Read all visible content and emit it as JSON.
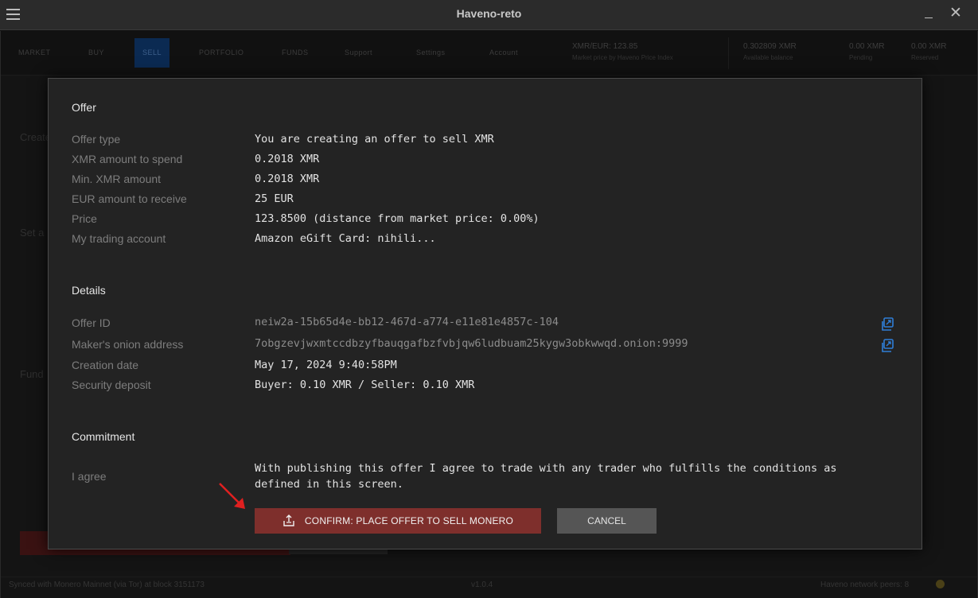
{
  "window": {
    "title": "Haveno-reto"
  },
  "nav": {
    "items": [
      "MARKET",
      "BUY",
      "SELL",
      "PORTFOLIO",
      "FUNDS",
      "Support",
      "Settings",
      "Account"
    ],
    "active": "SELL",
    "price": {
      "label": "XMR/EUR: 123.85",
      "sub": "Market price by Haveno Price Index"
    },
    "balances": [
      {
        "value": "0.302809 XMR",
        "label": "Available balance"
      },
      {
        "value": "0.00 XMR",
        "label": "Pending"
      },
      {
        "value": "0.00 XMR",
        "label": "Reserved"
      }
    ]
  },
  "background": {
    "create_heading": "Create",
    "set_heading": "Set a",
    "fund_heading": "Fund"
  },
  "status": {
    "left": "Synced with Monero Mainnet (via Tor) at block 3151173",
    "version": "v1.0.4",
    "peers": "Haveno network peers: 8"
  },
  "dialog": {
    "offer": {
      "title": "Offer",
      "rows": [
        {
          "label": "Offer type",
          "value": "You are creating an offer to sell XMR"
        },
        {
          "label": "XMR amount to spend",
          "value": "0.2018 XMR"
        },
        {
          "label": "Min. XMR amount",
          "value": "0.2018 XMR"
        },
        {
          "label": "EUR amount to receive",
          "value": "25 EUR"
        },
        {
          "label": "Price",
          "value": "123.8500 (distance from market price: 0.00%)"
        },
        {
          "label": "My trading account",
          "value": "Amazon eGift Card: nihili..."
        }
      ]
    },
    "details": {
      "title": "Details",
      "offer_id_label": "Offer ID",
      "offer_id": "neiw2a-15b65d4e-bb12-467d-a774-e11e81e4857c-104",
      "onion_label": "Maker's onion address",
      "onion": "7obgzevjwxmtccdbzyfbauqgafbzfvbjqw6ludbuam25kygw3obkwwqd.onion:9999",
      "creation_label": "Creation date",
      "creation": "May 17, 2024 9:40:58PM",
      "deposit_label": "Security deposit",
      "deposit": "Buyer: 0.10 XMR / Seller: 0.10 XMR"
    },
    "commitment": {
      "title": "Commitment",
      "label": "I agree",
      "text": "With publishing this offer I agree to trade with any trader who fulfills the conditions as defined in this screen."
    },
    "buttons": {
      "confirm": "CONFIRM: PLACE OFFER TO SELL MONERO",
      "cancel": "CANCEL"
    }
  },
  "colors": {
    "confirm": "#7e2f2c",
    "cancel": "#555555",
    "copy_icon": "#2f7ed8",
    "arrow": "#e02020"
  }
}
